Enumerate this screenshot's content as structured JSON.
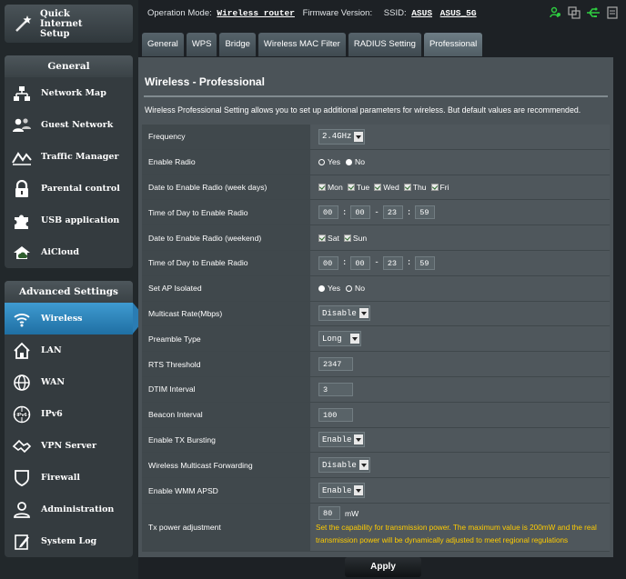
{
  "sidebar": {
    "qis_label": "Quick Internet Setup",
    "general_title": "General",
    "general_items": [
      {
        "label": "Network Map",
        "icon": "network-map-icon"
      },
      {
        "label": "Guest Network",
        "icon": "guest-network-icon"
      },
      {
        "label": "Traffic Manager",
        "icon": "traffic-manager-icon"
      },
      {
        "label": "Parental control",
        "icon": "lock-icon"
      },
      {
        "label": "USB application",
        "icon": "puzzle-icon"
      },
      {
        "label": "AiCloud",
        "icon": "cloud-icon"
      }
    ],
    "advanced_title": "Advanced Settings",
    "advanced_items": [
      {
        "label": "Wireless",
        "icon": "wifi-icon",
        "active": true
      },
      {
        "label": "LAN",
        "icon": "home-icon"
      },
      {
        "label": "WAN",
        "icon": "globe-icon"
      },
      {
        "label": "IPv6",
        "icon": "ipv6-icon"
      },
      {
        "label": "VPN Server",
        "icon": "vpn-icon"
      },
      {
        "label": "Firewall",
        "icon": "shield-icon"
      },
      {
        "label": "Administration",
        "icon": "user-icon"
      },
      {
        "label": "System Log",
        "icon": "log-icon"
      }
    ]
  },
  "status": {
    "mode_label": "Operation Mode:",
    "mode_value": "Wireless router",
    "firmware_label": "Firmware Version:",
    "ssid_label": "SSID:",
    "ssid_1": "ASUS",
    "ssid_2": "ASUS_5G"
  },
  "tabs": [
    "General",
    "WPS",
    "Bridge",
    "Wireless MAC Filter",
    "RADIUS Setting",
    "Professional"
  ],
  "panel": {
    "title": "Wireless - Professional",
    "description": "Wireless Professional Setting allows you to set up additional parameters for wireless. But default values are recommended."
  },
  "form": {
    "frequency": {
      "label": "Frequency",
      "value": "2.4GHz"
    },
    "enable_radio": {
      "label": "Enable Radio",
      "yes": "Yes",
      "no": "No"
    },
    "week_days": {
      "label": "Date to Enable Radio (week days)",
      "days": [
        "Mon",
        "Tue",
        "Wed",
        "Thu",
        "Fri"
      ]
    },
    "time_weekdays": {
      "label": "Time of Day to Enable Radio",
      "h1": "00",
      "m1": "00",
      "h2": "23",
      "m2": "59",
      "colon": ":",
      "dash": "-"
    },
    "weekend": {
      "label": "Date to Enable Radio (weekend)",
      "days": [
        "Sat",
        "Sun"
      ]
    },
    "time_weekend": {
      "label": "Time of Day to Enable Radio",
      "h1": "00",
      "m1": "00",
      "h2": "23",
      "m2": "59"
    },
    "ap_isolated": {
      "label": "Set AP Isolated",
      "yes": "Yes",
      "no": "No"
    },
    "multicast_rate": {
      "label": "Multicast Rate(Mbps)",
      "value": "Disable"
    },
    "preamble": {
      "label": "Preamble Type",
      "value": "Long"
    },
    "rts": {
      "label": "RTS Threshold",
      "value": "2347"
    },
    "dtim": {
      "label": "DTIM Interval",
      "value": "3"
    },
    "beacon": {
      "label": "Beacon Interval",
      "value": "100"
    },
    "tx_bursting": {
      "label": "Enable TX Bursting",
      "value": "Enable"
    },
    "multicast_forwarding": {
      "label": "Wireless Multicast Forwarding",
      "value": "Disable"
    },
    "wmm_apsd": {
      "label": "Enable WMM APSD",
      "value": "Enable"
    },
    "tx_power": {
      "label": "Tx power adjustment",
      "value": "80",
      "unit": "mW",
      "note": "Set the capability for transmission power. The maximum value is 200mW and the real transmission power will be dynamically adjusted to meet regional regulations"
    }
  },
  "apply_label": "Apply",
  "colors": {
    "active_nav": "#2a7cb3",
    "note": "#ffcc00",
    "panel": "#4b5358"
  }
}
